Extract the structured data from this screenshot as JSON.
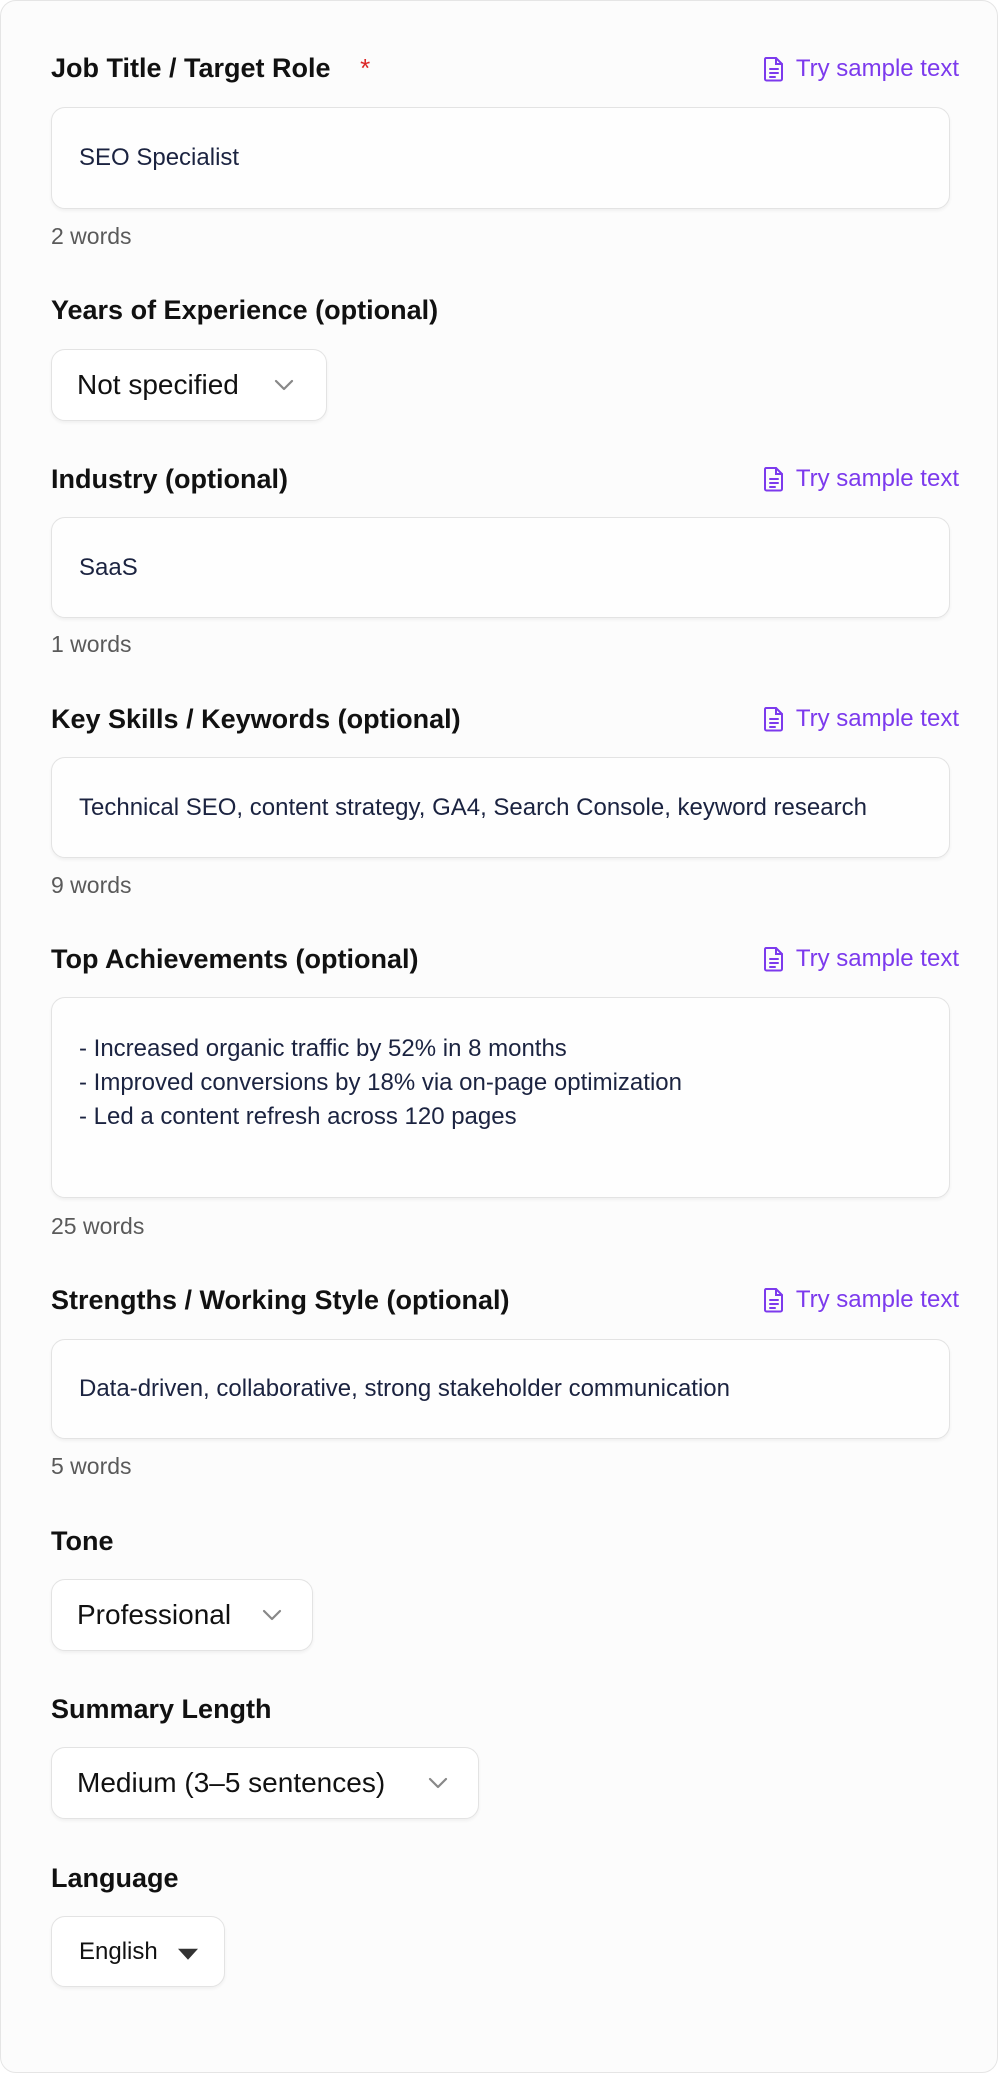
{
  "sample_link_label": "Try sample text",
  "job_title": {
    "label": "Job Title / Target Role",
    "required_marker": "*",
    "value": "SEO Specialist",
    "word_count": "2 words"
  },
  "experience": {
    "label": "Years of Experience (optional)",
    "selected": "Not specified"
  },
  "industry": {
    "label": "Industry (optional)",
    "value": "SaaS",
    "word_count": "1 words"
  },
  "skills": {
    "label": "Key Skills / Keywords (optional)",
    "value": "Technical SEO, content strategy, GA4, Search Console, keyword research",
    "word_count": "9 words"
  },
  "achievements": {
    "label": "Top Achievements (optional)",
    "lines": [
      "- Increased organic traffic by 52% in 8 months",
      "- Improved conversions by 18% via on-page optimization",
      "- Led a content refresh across 120 pages"
    ],
    "word_count": "25 words"
  },
  "strengths": {
    "label": "Strengths / Working Style (optional)",
    "value": "Data-driven, collaborative, strong stakeholder communication",
    "word_count": "5 words"
  },
  "tone": {
    "label": "Tone",
    "selected": "Professional"
  },
  "summary_length": {
    "label": "Summary Length",
    "selected": "Medium (3–5 sentences)"
  },
  "language": {
    "label": "Language",
    "selected": "English"
  },
  "colors": {
    "accent": "#7c3aed",
    "required": "#dc2626",
    "field_text": "#1b2340"
  },
  "icons": {
    "sample": "document-icon",
    "select_arrow": "chevron-down-icon",
    "language_arrow": "caret-down-icon"
  }
}
